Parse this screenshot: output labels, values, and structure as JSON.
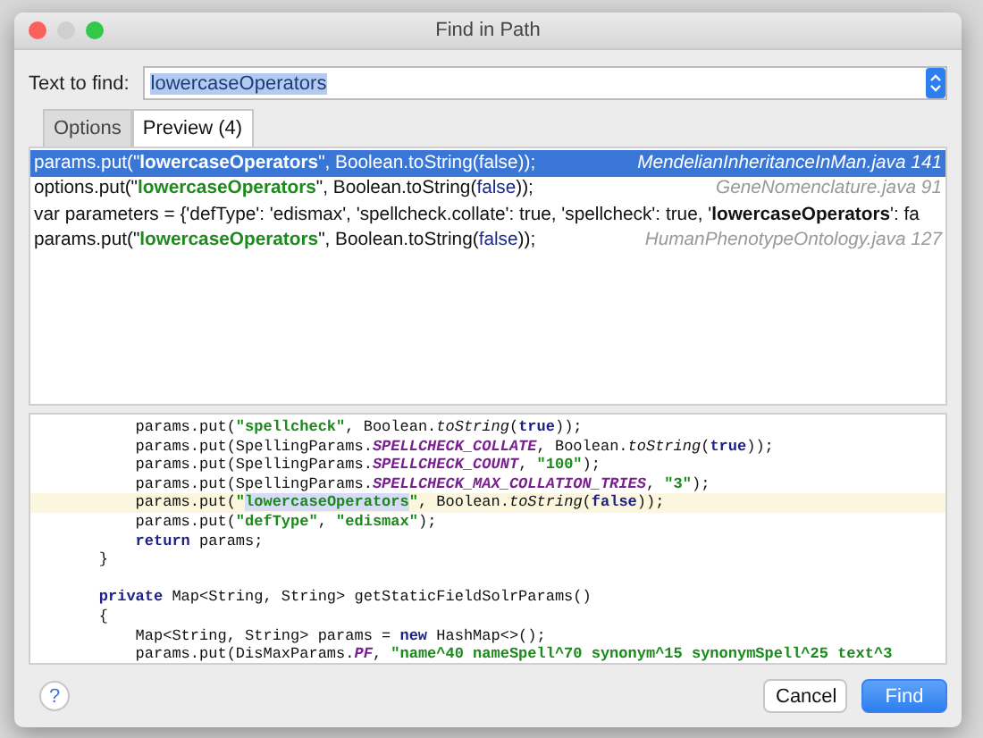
{
  "window": {
    "title": "Find in Path"
  },
  "search": {
    "label": "Text to find:",
    "value": "lowercaseOperators"
  },
  "tabs": [
    {
      "label": "Options",
      "selected": false
    },
    {
      "label": "Preview (4)",
      "selected": true
    }
  ],
  "results": [
    {
      "selected": true,
      "segments": [
        {
          "text": "params.put(\"",
          "kind": "plain"
        },
        {
          "text": "lowercaseOperators",
          "kind": "match"
        },
        {
          "text": "\", Boolean.toString(",
          "kind": "plain"
        },
        {
          "text": "false",
          "kind": "keyword"
        },
        {
          "text": "));",
          "kind": "plain"
        }
      ],
      "location": "MendelianInheritanceInMan.java 141"
    },
    {
      "selected": false,
      "segments": [
        {
          "text": "options.put(\"",
          "kind": "plain"
        },
        {
          "text": "lowercaseOperators",
          "kind": "match"
        },
        {
          "text": "\", Boolean.toString(",
          "kind": "plain"
        },
        {
          "text": "false",
          "kind": "keyword"
        },
        {
          "text": "));",
          "kind": "plain"
        }
      ],
      "location": "GeneNomenclature.java 91"
    },
    {
      "selected": false,
      "segments": [
        {
          "text": "var parameters = {'defType': 'edismax', 'spellcheck.collate': true, 'spellcheck': true, '",
          "kind": "plain"
        },
        {
          "text": "lowercaseOperators",
          "kind": "bold"
        },
        {
          "text": "': fa",
          "kind": "plain"
        }
      ]
    },
    {
      "selected": false,
      "segments": [
        {
          "text": "params.put(\"",
          "kind": "plain"
        },
        {
          "text": "lowercaseOperators",
          "kind": "match"
        },
        {
          "text": "\", Boolean.toString(",
          "kind": "plain"
        },
        {
          "text": "false",
          "kind": "keyword"
        },
        {
          "text": "));",
          "kind": "plain"
        }
      ],
      "location": "HumanPhenotypeOntology.java 127"
    }
  ],
  "code": [
    {
      "current": false,
      "tokens": [
        {
          "text": "        params.put(",
          "kind": "plain"
        },
        {
          "text": "\"spellcheck\"",
          "kind": "string"
        },
        {
          "text": ", Boolean.",
          "kind": "plain"
        },
        {
          "text": "toString",
          "kind": "method"
        },
        {
          "text": "(",
          "kind": "plain"
        },
        {
          "text": "true",
          "kind": "keyword"
        },
        {
          "text": "));",
          "kind": "plain"
        }
      ]
    },
    {
      "current": false,
      "tokens": [
        {
          "text": "        params.put(SpellingParams.",
          "kind": "plain"
        },
        {
          "text": "SPELLCHECK_COLLATE",
          "kind": "constant"
        },
        {
          "text": ", Boolean.",
          "kind": "plain"
        },
        {
          "text": "toString",
          "kind": "method"
        },
        {
          "text": "(",
          "kind": "plain"
        },
        {
          "text": "true",
          "kind": "keyword"
        },
        {
          "text": "));",
          "kind": "plain"
        }
      ]
    },
    {
      "current": false,
      "tokens": [
        {
          "text": "        params.put(SpellingParams.",
          "kind": "plain"
        },
        {
          "text": "SPELLCHECK_COUNT",
          "kind": "constant"
        },
        {
          "text": ", ",
          "kind": "plain"
        },
        {
          "text": "\"100\"",
          "kind": "string"
        },
        {
          "text": ");",
          "kind": "plain"
        }
      ]
    },
    {
      "current": false,
      "tokens": [
        {
          "text": "        params.put(SpellingParams.",
          "kind": "plain"
        },
        {
          "text": "SPELLCHECK_MAX_COLLATION_TRIES",
          "kind": "constant"
        },
        {
          "text": ", ",
          "kind": "plain"
        },
        {
          "text": "\"3\"",
          "kind": "string"
        },
        {
          "text": ");",
          "kind": "plain"
        }
      ]
    },
    {
      "current": true,
      "tokens": [
        {
          "text": "        params.put(",
          "kind": "plain"
        },
        {
          "text": "\"",
          "kind": "string"
        },
        {
          "text": "lowercaseOperators",
          "kind": "found"
        },
        {
          "text": "\"",
          "kind": "string"
        },
        {
          "text": ", Boolean.",
          "kind": "plain"
        },
        {
          "text": "toString",
          "kind": "method"
        },
        {
          "text": "(",
          "kind": "plain"
        },
        {
          "text": "false",
          "kind": "keyword"
        },
        {
          "text": "));",
          "kind": "plain"
        }
      ]
    },
    {
      "current": false,
      "tokens": [
        {
          "text": "        params.put(",
          "kind": "plain"
        },
        {
          "text": "\"defType\"",
          "kind": "string"
        },
        {
          "text": ", ",
          "kind": "plain"
        },
        {
          "text": "\"edismax\"",
          "kind": "string"
        },
        {
          "text": ");",
          "kind": "plain"
        }
      ]
    },
    {
      "current": false,
      "tokens": [
        {
          "text": "        return",
          "kind": "keyword"
        },
        {
          "text": " params;",
          "kind": "plain"
        }
      ]
    },
    {
      "current": false,
      "tokens": [
        {
          "text": "    }",
          "kind": "plain"
        }
      ]
    },
    {
      "current": false,
      "blank_before": true,
      "tokens": [
        {
          "text": "    private",
          "kind": "keyword"
        },
        {
          "text": " Map<String, String> getStaticFieldSolrParams()",
          "kind": "plain"
        }
      ]
    },
    {
      "current": false,
      "tokens": [
        {
          "text": "    {",
          "kind": "plain"
        }
      ]
    },
    {
      "current": false,
      "tokens": [
        {
          "text": "        Map<String, String> params = ",
          "kind": "plain"
        },
        {
          "text": "new",
          "kind": "keyword"
        },
        {
          "text": " HashMap<>();",
          "kind": "plain"
        }
      ]
    },
    {
      "current": false,
      "tokens": [
        {
          "text": "        params.put(DisMaxParams.",
          "kind": "plain"
        },
        {
          "text": "PF",
          "kind": "constant"
        },
        {
          "text": ", ",
          "kind": "plain"
        },
        {
          "text": "\"name^40 nameSpell^70 synonym^15 synonymSpell^25 text^3",
          "kind": "string"
        }
      ]
    }
  ],
  "help": {
    "label": "?"
  },
  "buttons": [
    {
      "label": "Cancel",
      "kind": "secondary"
    },
    {
      "label": "Find",
      "kind": "primary"
    }
  ]
}
